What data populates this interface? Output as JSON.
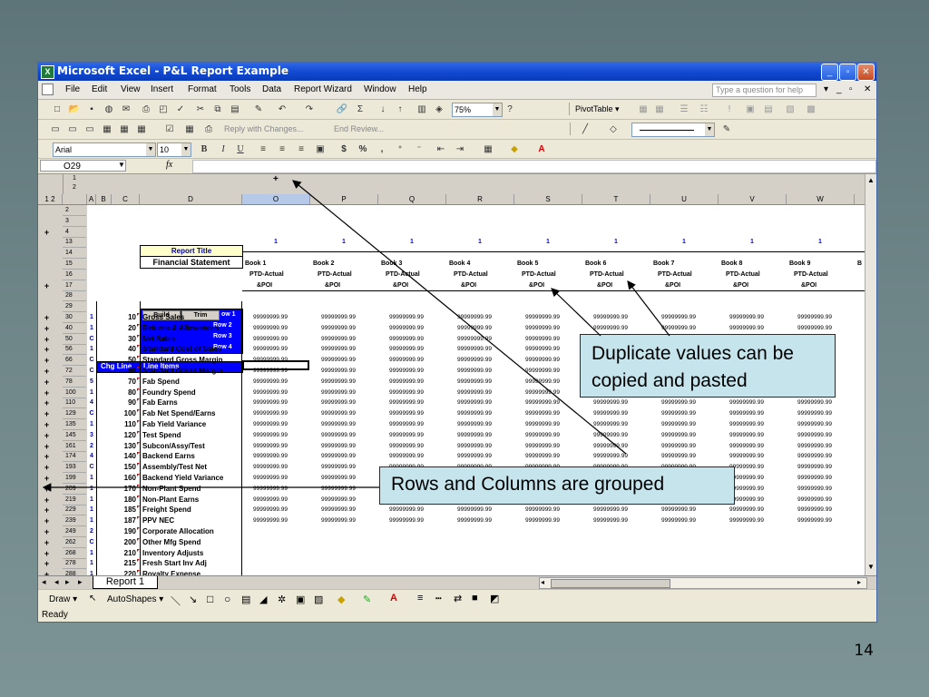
{
  "slide_number": "14",
  "window": {
    "app_icon": "excel-icon",
    "title": "Microsoft Excel - P&L Report Example",
    "buttons": [
      "_",
      "▫",
      "✕"
    ]
  },
  "menu": {
    "items": [
      "File",
      "Edit",
      "View",
      "Insert",
      "Format",
      "Tools",
      "Data",
      "Report Wizard",
      "Window",
      "Help"
    ],
    "help_placeholder": "Type a question for help",
    "right_controls": [
      "▾",
      "_",
      "▫",
      "✕"
    ]
  },
  "toolbar": {
    "zoom": "75%",
    "pivot_table": "PivotTable ▾",
    "reply_text": "Reply with Changes...",
    "end_review": "End Review...",
    "font_name": "Arial",
    "font_size": "10",
    "bold": "B",
    "italic": "I",
    "underline": "U",
    "currency": "$",
    "percent": "%",
    "comma": ","
  },
  "formula_bar": {
    "cell_ref": "O29",
    "fx": "fx"
  },
  "grid": {
    "outline_levels": [
      "1",
      "2"
    ],
    "row_outline_levels": [
      "1",
      "2"
    ],
    "column_headers": [
      "A",
      "B",
      "C",
      "D",
      "O",
      "P",
      "Q",
      "R",
      "S",
      "T",
      "U",
      "V",
      "W"
    ],
    "row_numbers": [
      "2",
      "3",
      "4",
      "13",
      "14",
      "15",
      "16",
      "17",
      "28",
      "29",
      "30",
      "40",
      "50",
      "56",
      "66",
      "72",
      "78",
      "100",
      "110",
      "129",
      "135",
      "145",
      "161",
      "174",
      "193",
      "199",
      "209",
      "219",
      "229",
      "239",
      "249",
      "262",
      "268",
      "278",
      "288"
    ],
    "report_title_label": "Report Title",
    "financial_statement": "Financial Statement",
    "build_btn": "Build",
    "trim_btn": "Trim",
    "row_labels": [
      "ow 1",
      "Row 2",
      "Row 3",
      "Row 4"
    ],
    "book_col_flag": "1",
    "books": [
      "Book 1",
      "Book 2",
      "Book 3",
      "Book 4",
      "Book 5",
      "Book 6",
      "Book 7",
      "Book 8",
      "Book 9",
      "B"
    ],
    "ptd": "PTD-Actual",
    "poi": "&POI",
    "header_chg_line": "Chg Line",
    "header_line_items": "Line Items",
    "value_text": "99999999.99",
    "line_items": [
      {
        "flag": "1",
        "chg": "10",
        "name": "Gross Sales"
      },
      {
        "flag": "1",
        "chg": "20",
        "name": "Returns & Allowances"
      },
      {
        "flag": "C",
        "chg": "30",
        "name": "Net Sales"
      },
      {
        "flag": "1",
        "chg": "40",
        "name": "Standard Cost of Sales"
      },
      {
        "flag": "C",
        "chg": "50",
        "name": "Standard Gross Margin"
      },
      {
        "flag": "C",
        "chg": "60",
        "name": "Standard Gross Margin"
      },
      {
        "flag": "5",
        "chg": "70",
        "name": "Fab Spend"
      },
      {
        "flag": "1",
        "chg": "80",
        "name": "Foundry Spend"
      },
      {
        "flag": "4",
        "chg": "90",
        "name": "Fab Earns"
      },
      {
        "flag": "C",
        "chg": "100",
        "name": "Fab Net Spend/Earns"
      },
      {
        "flag": "1",
        "chg": "110",
        "name": "Fab Yield Variance"
      },
      {
        "flag": "3",
        "chg": "120",
        "name": "Test Spend"
      },
      {
        "flag": "2",
        "chg": "130",
        "name": "Subcon/Assy/Test"
      },
      {
        "flag": "4",
        "chg": "140",
        "name": "Backend Earns"
      },
      {
        "flag": "C",
        "chg": "150",
        "name": "Assembly/Test Net"
      },
      {
        "flag": "1",
        "chg": "160",
        "name": "Backend Yield Variance"
      },
      {
        "flag": "1",
        "chg": "170",
        "name": "Non-Plant Spend"
      },
      {
        "flag": "1",
        "chg": "180",
        "name": "Non-Plant Earns"
      },
      {
        "flag": "1",
        "chg": "185",
        "name": "Freight Spend"
      },
      {
        "flag": "1",
        "chg": "187",
        "name": "PPV NEC"
      },
      {
        "flag": "2",
        "chg": "190",
        "name": "Corporate Allocation"
      },
      {
        "flag": "C",
        "chg": "200",
        "name": "Other Mfg Spend"
      },
      {
        "flag": "1",
        "chg": "210",
        "name": "Inventory Adjusts"
      },
      {
        "flag": "1",
        "chg": "215",
        "name": "Fresh Start Inv Adj"
      },
      {
        "flag": "1",
        "chg": "220",
        "name": "Royalty Expense"
      }
    ]
  },
  "sheet_tab": "Report 1",
  "draw_bar": {
    "draw": "Draw ▾",
    "autoshapes": "AutoShapes ▾"
  },
  "status": "Ready",
  "callouts": {
    "duplicate": "Duplicate values can be copied and pasted",
    "grouped": "Rows and Columns are grouped"
  },
  "colors": {
    "header_blue": "#0000ff",
    "callout_bg": "#c6e4ec",
    "title_yellow": "#ffffcc",
    "titlebar_blue": "#1048d0"
  }
}
